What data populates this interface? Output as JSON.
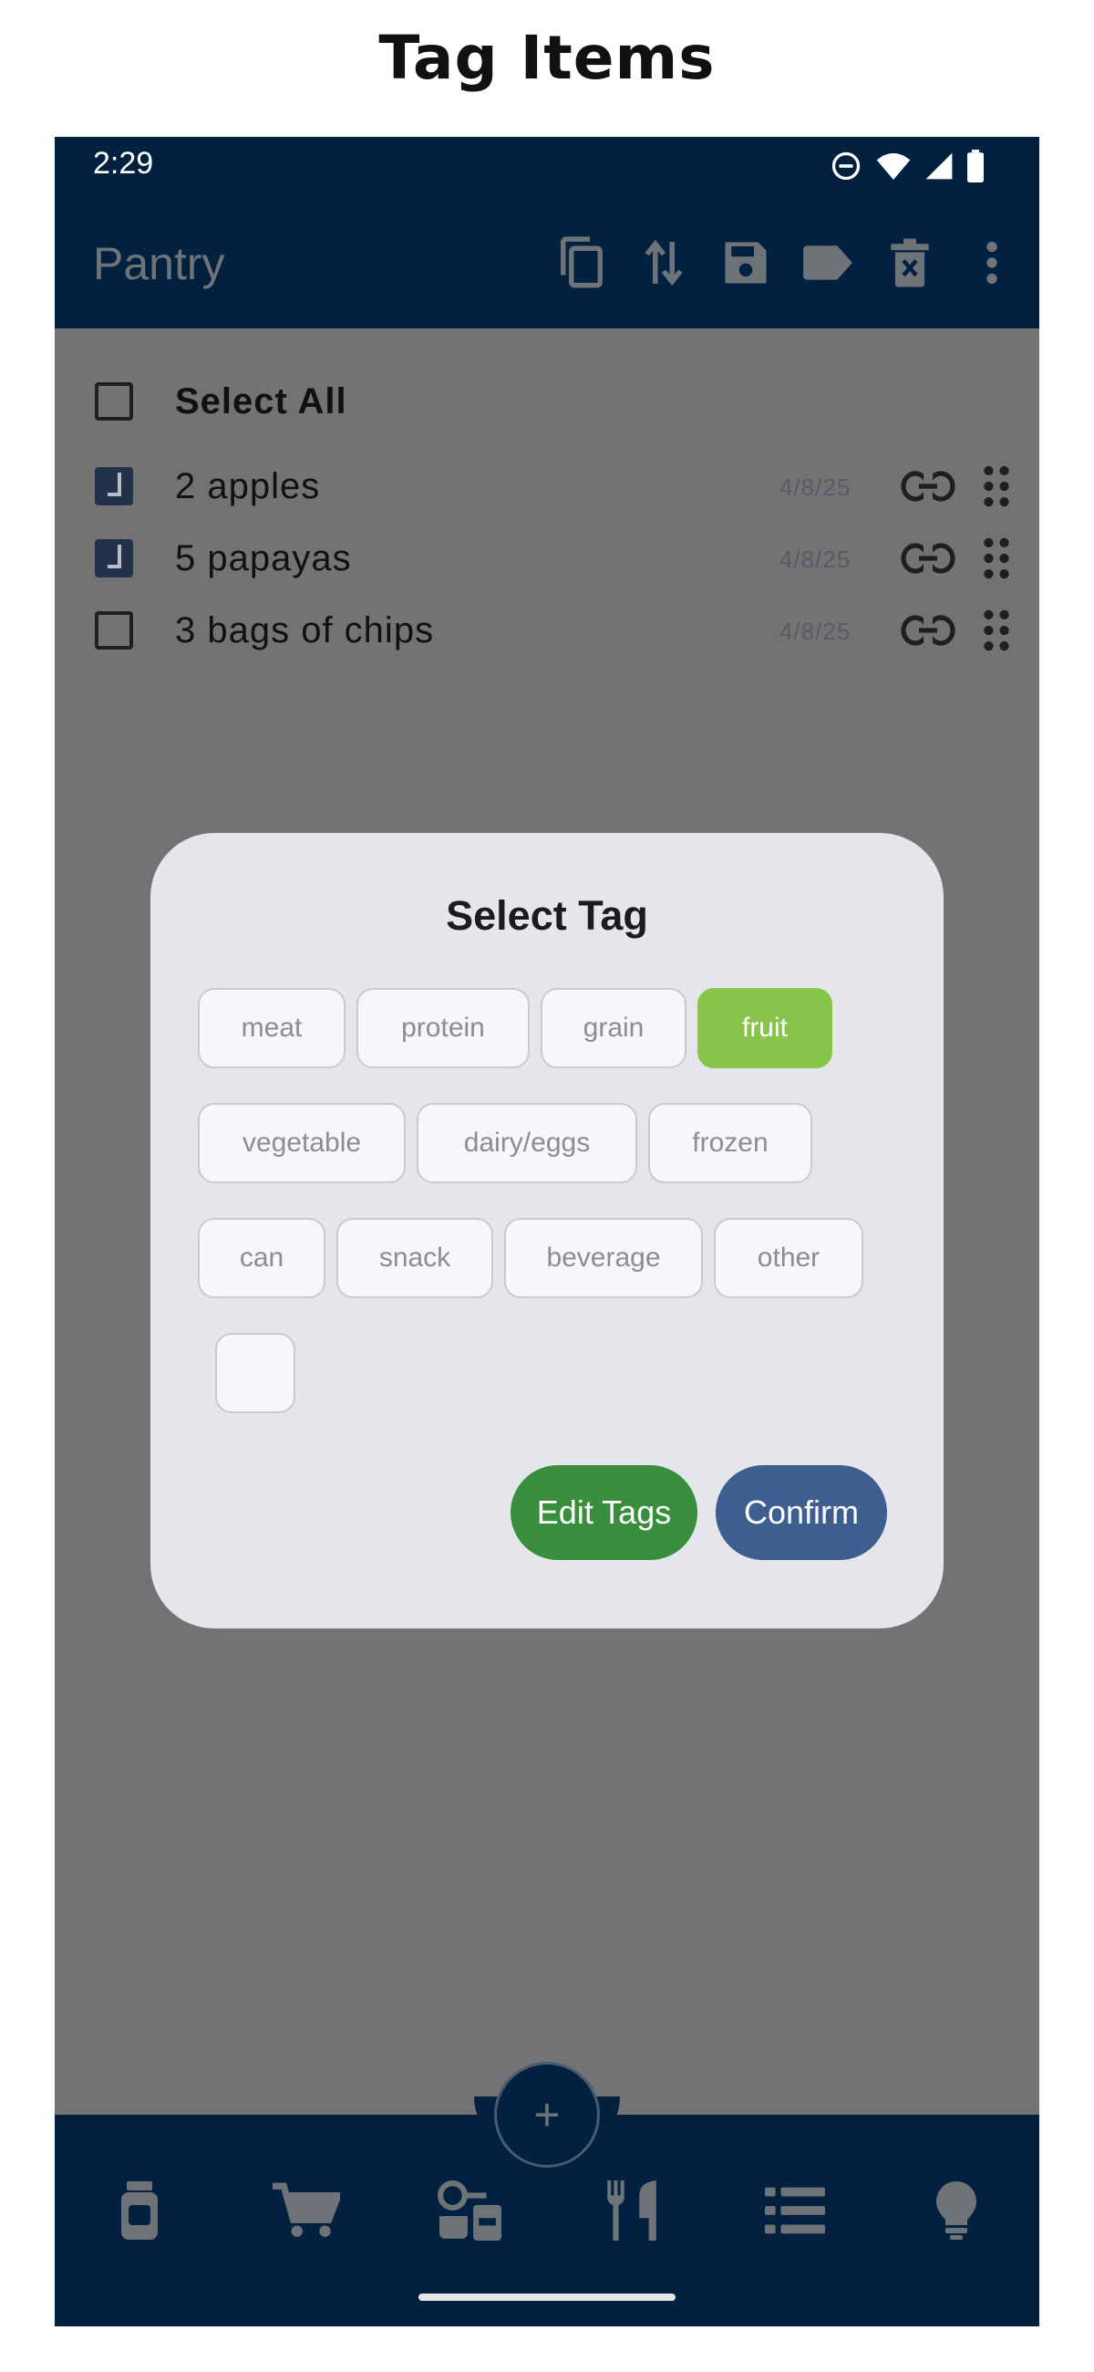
{
  "caption": "Tag Items",
  "status_bar": {
    "time": "2:29",
    "icons": [
      "do-not-disturb-icon",
      "wifi-icon",
      "signal-icon",
      "battery-icon"
    ]
  },
  "app_bar": {
    "title": "Pantry",
    "actions": [
      "copy-icon",
      "sort-icon",
      "save-icon",
      "tag-icon",
      "delete-icon",
      "more-vert-icon"
    ]
  },
  "list": {
    "select_all_label": "Select All",
    "items": [
      {
        "label": "2 apples",
        "date": "4/8/25",
        "checked": true
      },
      {
        "label": "5 papayas",
        "date": "4/8/25",
        "checked": true
      },
      {
        "label": "3 bags of chips",
        "date": "4/8/25",
        "checked": false
      }
    ]
  },
  "dialog": {
    "title": "Select Tag",
    "tags": [
      "meat",
      "protein",
      "grain",
      "fruit",
      "vegetable",
      "dairy/eggs",
      "frozen",
      "can",
      "snack",
      "beverage",
      "other",
      ""
    ],
    "selected_tag": "fruit",
    "edit_label": "Edit Tags",
    "confirm_label": "Confirm"
  },
  "fab": {
    "label": "+"
  },
  "bottom_nav": [
    "pantry-jar-icon",
    "cart-icon",
    "ingredients-icon",
    "utensils-icon",
    "list-icon",
    "lightbulb-icon"
  ],
  "colors": {
    "app_bar": "#022140",
    "scrim": "#737375",
    "dialog_bg": "#e5e6eb",
    "chip_selected": "#86c44a",
    "edit_button": "#388e3c",
    "confirm_button": "#3d5e8e"
  }
}
